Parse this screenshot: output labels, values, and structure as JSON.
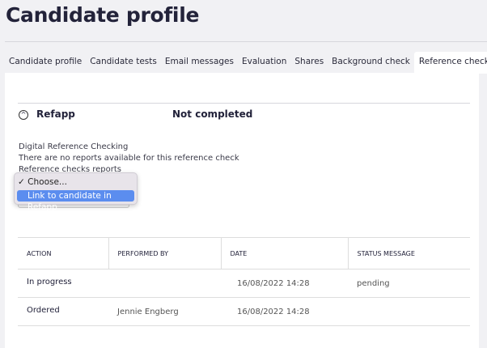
{
  "page": {
    "title": "Candidate profile"
  },
  "tabs": [
    {
      "label": "Candidate profile"
    },
    {
      "label": "Candidate tests"
    },
    {
      "label": "Email messages"
    },
    {
      "label": "Evaluation"
    },
    {
      "label": "Shares"
    },
    {
      "label": "Background check"
    },
    {
      "label": "Reference checks",
      "active": true
    }
  ],
  "section": {
    "name": "Refapp",
    "status": "Not completed",
    "icon": "chevron-up-circle-icon",
    "lines": [
      "Digital Reference Checking",
      "There are no reports available for this reference check",
      "Reference checks reports"
    ]
  },
  "dropdown": {
    "options": [
      "Choose...",
      "Link to candidate in Refapp"
    ],
    "checked": "Choose...",
    "highlighted": "Link to candidate in Refapp",
    "check_mark": "✓"
  },
  "table": {
    "headers": [
      "ACTION",
      "PERFORMED BY",
      "DATE",
      "STATUS MESSAGE"
    ],
    "rows": [
      [
        "In progress",
        "",
        "16/08/2022 14:28",
        "pending"
      ],
      [
        "Ordered",
        "Jennie Engberg",
        "16/08/2022 14:28",
        ""
      ]
    ]
  },
  "colors": {
    "highlight": "#5b8def",
    "background": "#f1f1f4"
  }
}
